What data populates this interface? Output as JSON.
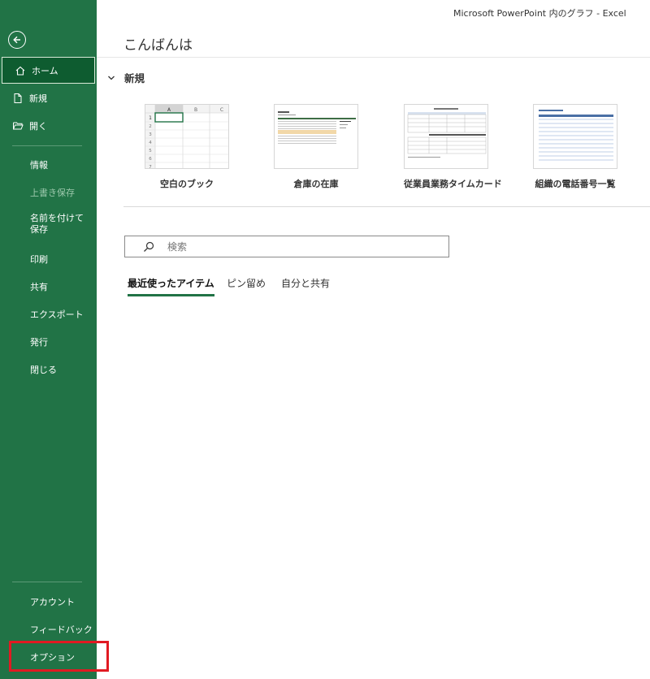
{
  "window": {
    "title": "Microsoft PowerPoint 内のグラフ  -  Excel"
  },
  "sidebar": {
    "items": [
      {
        "label": "ホーム",
        "icon": "home-icon"
      },
      {
        "label": "新規",
        "icon": "new-document-icon"
      },
      {
        "label": "開く",
        "icon": "open-folder-icon"
      },
      {
        "label": "情報"
      },
      {
        "label": "上書き保存"
      },
      {
        "label": "名前を付けて保存"
      },
      {
        "label": "印刷"
      },
      {
        "label": "共有"
      },
      {
        "label": "エクスポート"
      },
      {
        "label": "発行"
      },
      {
        "label": "閉じる"
      },
      {
        "label": "アカウント"
      },
      {
        "label": "フィードバック"
      },
      {
        "label": "オプション"
      }
    ],
    "accent": "#217346",
    "highlight_color": "#e11a22"
  },
  "main": {
    "greeting": "こんばんは",
    "new_section": {
      "title": "新規",
      "templates": [
        {
          "label": "空白のブック"
        },
        {
          "label": "倉庫の在庫"
        },
        {
          "label": "従業員業務タイムカード"
        },
        {
          "label": "組織の電話番号一覧"
        }
      ]
    },
    "search": {
      "placeholder": "検索"
    },
    "tabs": [
      {
        "label": "最近使ったアイテム",
        "active": true
      },
      {
        "label": "ピン留め"
      },
      {
        "label": "自分と共有"
      }
    ]
  },
  "blank_workbook_preview": {
    "columns": [
      "A",
      "B",
      "C"
    ],
    "rows": [
      "1",
      "2",
      "3",
      "4",
      "5",
      "6",
      "7"
    ]
  }
}
